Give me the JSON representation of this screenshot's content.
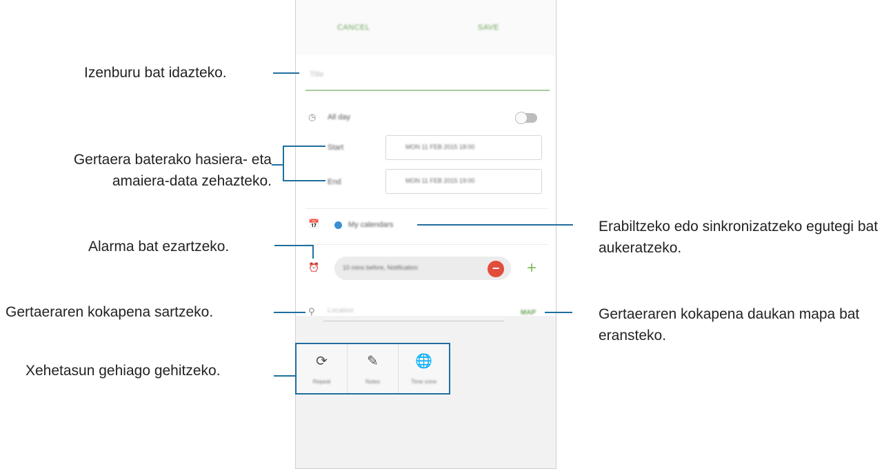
{
  "annotations": {
    "title": "Izenburu bat idazteko.",
    "dates": "Gertaera baterako hasiera- eta amaiera-data zehazteko.",
    "alarm": "Alarma bat ezartzeko.",
    "location": "Gertaeraren kokapena sartzeko.",
    "details": "Xehetasun gehiago gehitzeko.",
    "calendar": "Erabiltzeko edo sinkronizatzeko egutegi bat aukeratzeko.",
    "map": "Gertaeraren kokapena daukan mapa bat eransteko."
  },
  "header": {
    "cancel": "CANCEL",
    "save": "SAVE"
  },
  "form": {
    "title_placeholder": "Title",
    "all_day": "All day",
    "all_day_on": false,
    "start_label": "Start",
    "start_value": "MON 11 FEB 2015   18:00",
    "end_label": "End",
    "end_value": "MON 11 FEB 2015   19:00",
    "calendar_name": "My calendars",
    "calendar_color": "#3b8ed0",
    "reminder": "10 mins before, Notification",
    "location_placeholder": "Location",
    "map_label": "MAP"
  },
  "extras": [
    {
      "icon": "repeat-icon",
      "label": "Repeat"
    },
    {
      "icon": "notes-icon",
      "label": "Notes"
    },
    {
      "icon": "time-zone-icon",
      "label": "Time zone"
    }
  ],
  "colors": {
    "accent": "#6aa35a",
    "callout": "#1f6e9e",
    "delete": "#e24c3b"
  }
}
